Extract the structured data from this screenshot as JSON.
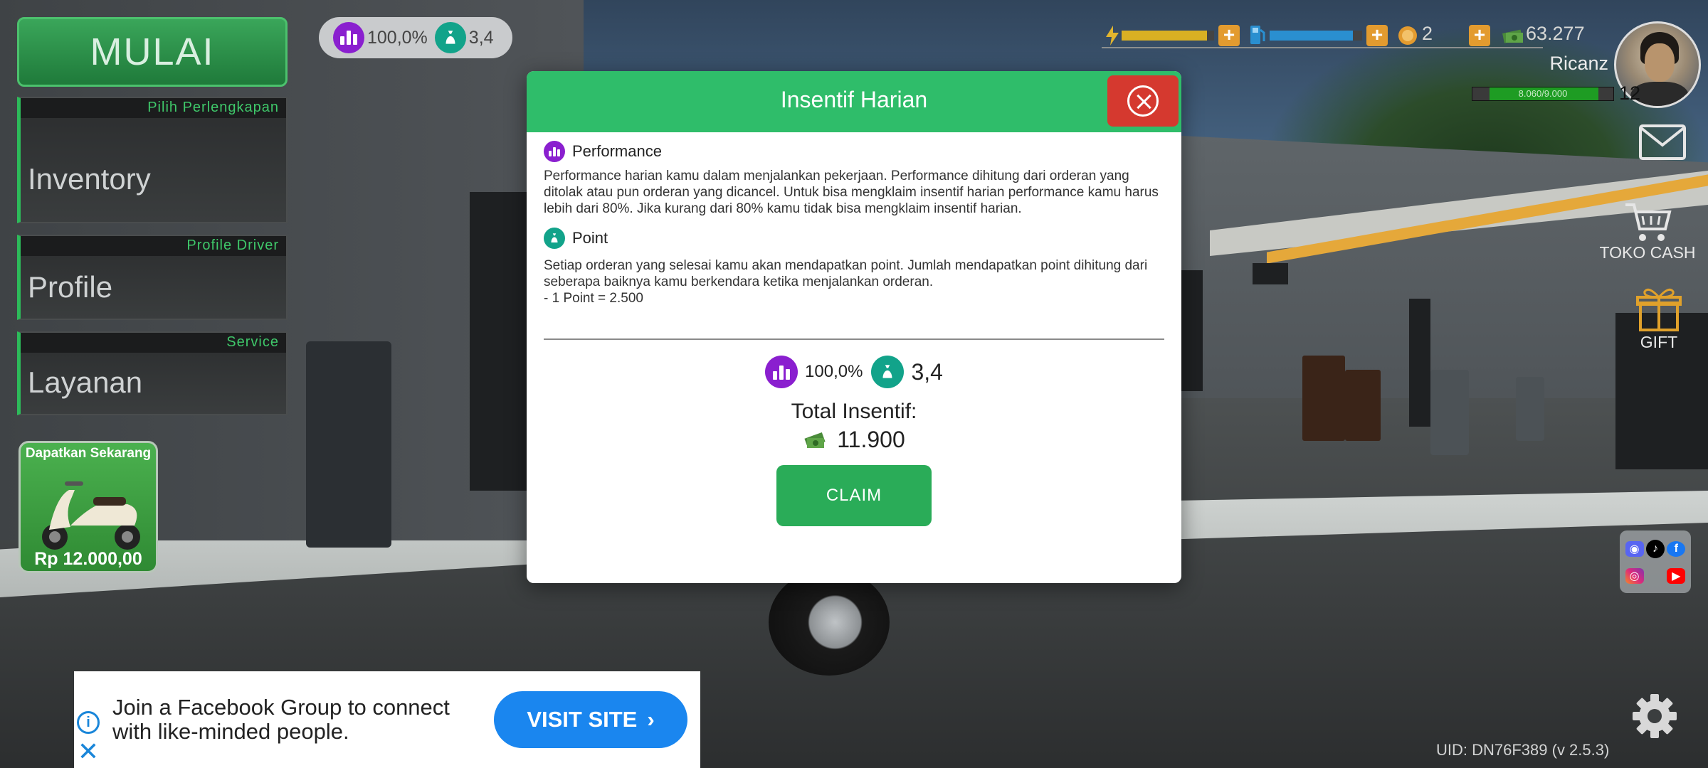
{
  "left_menu": {
    "start_label": "MULAI",
    "cards": [
      {
        "hint": "Pilih Perlengkapan",
        "label": "Inventory"
      },
      {
        "hint": "Profile Driver",
        "label": "Profile"
      },
      {
        "hint": "Service",
        "label": "Layanan"
      }
    ],
    "promo": {
      "title": "Dapatkan Sekarang",
      "price": "Rp 12.000,00"
    }
  },
  "stats": {
    "performance": "100,0%",
    "point": "3,4"
  },
  "top_hud": {
    "coins": "2",
    "cash": "63.277",
    "player_name": "Ricanz",
    "xp_text": "8.060/9.000",
    "xp_fraction": 0.896,
    "level": "12",
    "energy_fraction": 0.92,
    "fuel_fraction": 0.9
  },
  "side_buttons": {
    "shop_label": "TOKO CASH",
    "gift_label": "GIFT"
  },
  "modal": {
    "title": "Insentif Harian",
    "performance_title": "Performance",
    "performance_text": "Performance harian kamu dalam menjalankan pekerjaan. Performance dihitung dari orderan yang ditolak atau pun orderan yang dicancel. Untuk bisa mengklaim insentif harian performance kamu harus lebih dari 80%. Jika kurang dari 80% kamu tidak bisa mengklaim insentif harian.",
    "point_title": "Point",
    "point_text": "Setiap orderan yang selesai kamu akan mendapatkan point. Jumlah mendapatkan point dihitung dari seberapa baiknya kamu berkendara ketika menjalankan orderan.",
    "point_rate": "- 1 Point = 2.500",
    "summary_performance": "100,0%",
    "summary_point": "3,4",
    "total_label": "Total Insentif:",
    "total_value": "11.900",
    "claim_label": "CLAIM"
  },
  "ad": {
    "text": "Join a Facebook Group to connect with like-minded people.",
    "cta": "VISIT SITE"
  },
  "footer": {
    "uid": "UID: DN76F389 (v 2.5.3)"
  },
  "colors": {
    "accent_green": "#2fbd6a",
    "close_red": "#d5392f",
    "performance_purple": "#8a1fcf",
    "point_teal": "#12a38a",
    "ad_blue": "#1a86ef"
  }
}
